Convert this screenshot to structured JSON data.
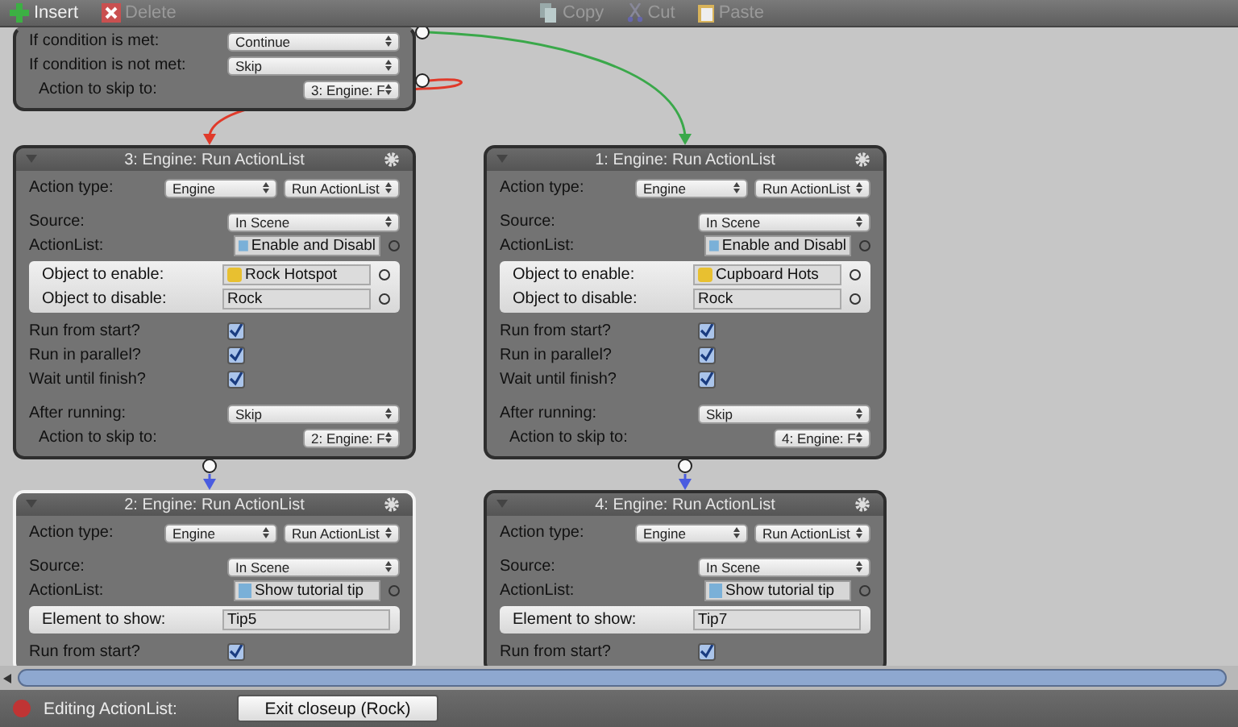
{
  "toolbar": [
    {
      "label": "Insert",
      "disabled": false
    },
    {
      "label": "Delete",
      "disabled": true
    },
    {
      "label": "Copy",
      "disabled": true
    },
    {
      "label": "Cut",
      "disabled": true
    },
    {
      "label": "Paste",
      "disabled": true
    }
  ],
  "nodes": [
    {
      "selected": false,
      "rows": [
        {
          "kind": "select",
          "label": "If condition is met:",
          "value": "Continue"
        },
        {
          "kind": "select",
          "label": "If condition is not met:",
          "value": "Skip"
        },
        {
          "kind": "skip",
          "label": "Action to skip to:",
          "value": "3: Engine: F"
        }
      ]
    },
    {
      "title": "3: Engine: Run ActionList",
      "selected": false,
      "rows": [
        {
          "kind": "double",
          "label": "Action type:",
          "values": [
            "Engine",
            "Run ActionList"
          ]
        },
        {
          "kind": "select",
          "label": "Source:",
          "value": "In Scene"
        },
        {
          "kind": "asset",
          "label": "ActionList:",
          "value": "Enable and Disabl"
        },
        {
          "kind": "group",
          "fields": [
            {
              "kind": "object",
              "label": "Object to enable:",
              "value": "Rock Hotspot"
            },
            {
              "kind": "plain",
              "label": "Object to disable:",
              "value": "Rock"
            }
          ]
        },
        {
          "kind": "check",
          "label": "Run from start?",
          "checked": true
        },
        {
          "kind": "check",
          "label": "Run in parallel?",
          "checked": true
        },
        {
          "kind": "check",
          "label": "Wait until finish?",
          "checked": true
        },
        {
          "kind": "select",
          "label": "After running:",
          "value": "Skip"
        },
        {
          "kind": "skip",
          "label": "Action to skip to:",
          "value": "2: Engine: F"
        }
      ]
    },
    {
      "title": "1: Engine: Run ActionList",
      "selected": false,
      "rows": [
        {
          "kind": "double",
          "label": "Action type:",
          "values": [
            "Engine",
            "Run ActionList"
          ]
        },
        {
          "kind": "select",
          "label": "Source:",
          "value": "In Scene"
        },
        {
          "kind": "asset",
          "label": "ActionList:",
          "value": "Enable and Disabl"
        },
        {
          "kind": "group",
          "fields": [
            {
              "kind": "object",
              "label": "Object to enable:",
              "value": "Cupboard Hots"
            },
            {
              "kind": "plain",
              "label": "Object to disable:",
              "value": "Rock"
            }
          ]
        },
        {
          "kind": "check",
          "label": "Run from start?",
          "checked": true
        },
        {
          "kind": "check",
          "label": "Run in parallel?",
          "checked": true
        },
        {
          "kind": "check",
          "label": "Wait until finish?",
          "checked": true
        },
        {
          "kind": "select",
          "label": "After running:",
          "value": "Skip"
        },
        {
          "kind": "skip",
          "label": "Action to skip to:",
          "value": "4: Engine: F"
        }
      ]
    },
    {
      "title": "2: Engine: Run ActionList",
      "selected": true,
      "rows": [
        {
          "kind": "double",
          "label": "Action type:",
          "values": [
            "Engine",
            "Run ActionList"
          ]
        },
        {
          "kind": "select",
          "label": "Source:",
          "value": "In Scene"
        },
        {
          "kind": "asset",
          "label": "ActionList:",
          "value": "Show tutorial tip"
        },
        {
          "kind": "group",
          "fields": [
            {
              "kind": "text",
              "label": "Element to show:",
              "value": "Tip5"
            }
          ]
        },
        {
          "kind": "check",
          "label": "Run from start?",
          "checked": true
        }
      ]
    },
    {
      "title": "4: Engine: Run ActionList",
      "selected": false,
      "rows": [
        {
          "kind": "double",
          "label": "Action type:",
          "values": [
            "Engine",
            "Run ActionList"
          ]
        },
        {
          "kind": "select",
          "label": "Source:",
          "value": "In Scene"
        },
        {
          "kind": "asset",
          "label": "ActionList:",
          "value": "Show tutorial tip"
        },
        {
          "kind": "group",
          "fields": [
            {
              "kind": "text",
              "label": "Element to show:",
              "value": "Tip7"
            }
          ]
        },
        {
          "kind": "check",
          "label": "Run from start?",
          "checked": true
        }
      ]
    }
  ],
  "status_bar": {
    "label": "Editing ActionList:",
    "button": "Exit closeup (Rock)"
  }
}
